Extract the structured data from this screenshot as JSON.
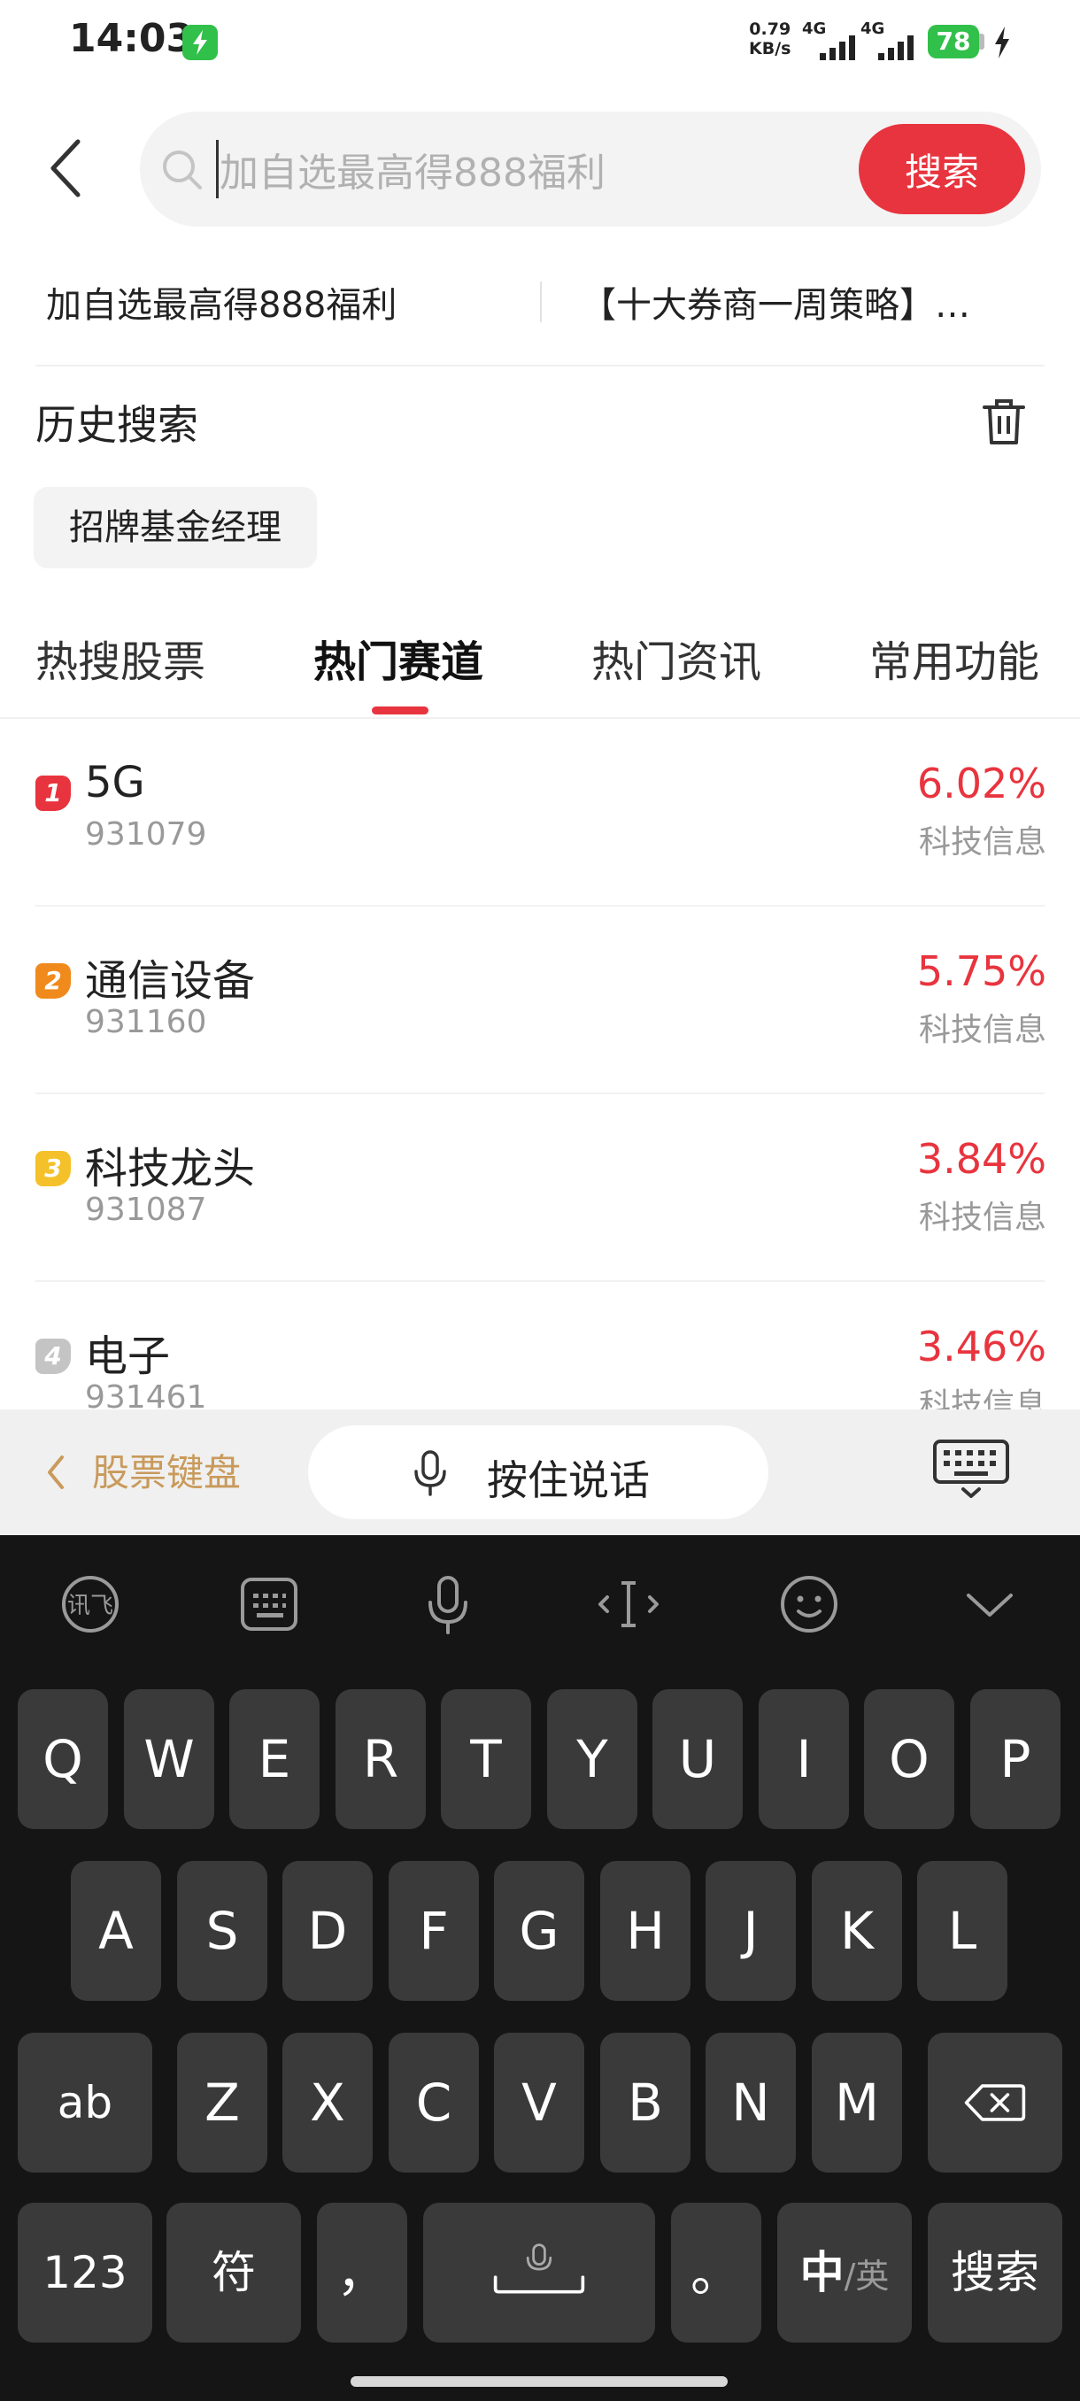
{
  "status": {
    "time": "14:03",
    "net_speed_value": "0.79",
    "net_speed_unit": "KB/s",
    "signal1_label": "4G",
    "signal2_label": "4G",
    "battery": "78"
  },
  "search": {
    "placeholder": "加自选最高得888福利",
    "button_label": "搜索"
  },
  "promo": {
    "left": "加自选最高得888福利",
    "right": "【十大券商一周策略】…"
  },
  "history": {
    "title": "历史搜索",
    "items": [
      "招牌基金经理"
    ]
  },
  "tabs": [
    {
      "label": "热搜股票",
      "active": false
    },
    {
      "label": "热门赛道",
      "active": true
    },
    {
      "label": "热门资讯",
      "active": false
    },
    {
      "label": "常用功能",
      "active": false
    }
  ],
  "list": [
    {
      "rank": "1",
      "name": "5G",
      "code": "931079",
      "change": "6.02%",
      "sector": "科技信息",
      "badge_color": "#e8343e"
    },
    {
      "rank": "2",
      "name": "通信设备",
      "code": "931160",
      "change": "5.75%",
      "sector": "科技信息",
      "badge_color": "#f08a1c"
    },
    {
      "rank": "3",
      "name": "科技龙头",
      "code": "931087",
      "change": "3.84%",
      "sector": "科技信息",
      "badge_color": "#f5c12a"
    },
    {
      "rank": "4",
      "name": "电子",
      "code": "931461",
      "change": "3.46%",
      "sector": "科技信息",
      "badge_color": "#c4c4c4"
    }
  ],
  "toolbar": {
    "stock_keyboard": "股票键盘",
    "voice": "按住说话"
  },
  "keyboard": {
    "row1": [
      "Q",
      "W",
      "E",
      "R",
      "T",
      "Y",
      "U",
      "I",
      "O",
      "P"
    ],
    "row2": [
      "A",
      "S",
      "D",
      "F",
      "G",
      "H",
      "J",
      "K",
      "L"
    ],
    "row3": [
      "Z",
      "X",
      "C",
      "V",
      "B",
      "N",
      "M"
    ],
    "shift_label": "ab",
    "num_label": "123",
    "symbol_label": "符",
    "comma_label": "，",
    "period_label": "。",
    "lang_primary": "中",
    "lang_secondary": "/英",
    "search_label": "搜索"
  },
  "colors": {
    "accent": "#e8343e",
    "gold": "#c99a5b",
    "keyboard_bg": "#151515",
    "key_bg": "#3a3a3a"
  }
}
